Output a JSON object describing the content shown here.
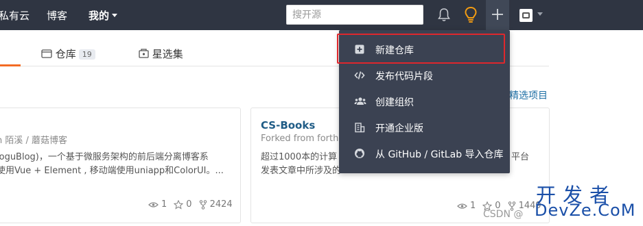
{
  "nav": {
    "brand_partial": "私有云",
    "blog": "博客",
    "mine": "我的",
    "search_placeholder": "搜开源"
  },
  "tabs": [
    {
      "label": "仓库",
      "count": "19"
    },
    {
      "label": "星选集"
    }
  ],
  "featured_link": "精选项目",
  "cards": [
    {
      "meta": "n 陌溪 / 蘑菇博客",
      "desc_line1": "loguBlog)，一个基于微服务架构的前后端分离博客系",
      "desc_line2": "使用Vue + Element , 移动端使用uniapp和ColorUI。...",
      "watchers": "1",
      "stars": "0",
      "forks": "2424"
    },
    {
      "title": "CS-Books",
      "meta": "Forked from forthe",
      "desc_line1": "超过1000本的计算",
      "desc_line1_tail": "平台",
      "desc_line2": "发表文章中所涉及的",
      "watchers": "1",
      "stars": "0",
      "forks": "1449"
    }
  ],
  "dropdown": {
    "items": [
      {
        "label": "新建仓库",
        "icon": "plus-square-icon"
      },
      {
        "label": "发布代码片段",
        "icon": "code-icon"
      },
      {
        "label": "创建组织",
        "icon": "users-icon"
      },
      {
        "label": "开通企业版",
        "icon": "building-icon"
      },
      {
        "label": "从 GitHub / GitLab 导入仓库",
        "icon": "github-icon"
      }
    ]
  },
  "watermark": {
    "chars": "开发者",
    "domain": "DevZe.CoM",
    "csdn": "CSDN @"
  },
  "colors": {
    "nav_bg": "#2f3542",
    "dropdown_bg": "#3b4252",
    "accent_orange": "#f36b24",
    "highlight_red": "#e0272c",
    "link_blue": "#1c6ea4"
  }
}
